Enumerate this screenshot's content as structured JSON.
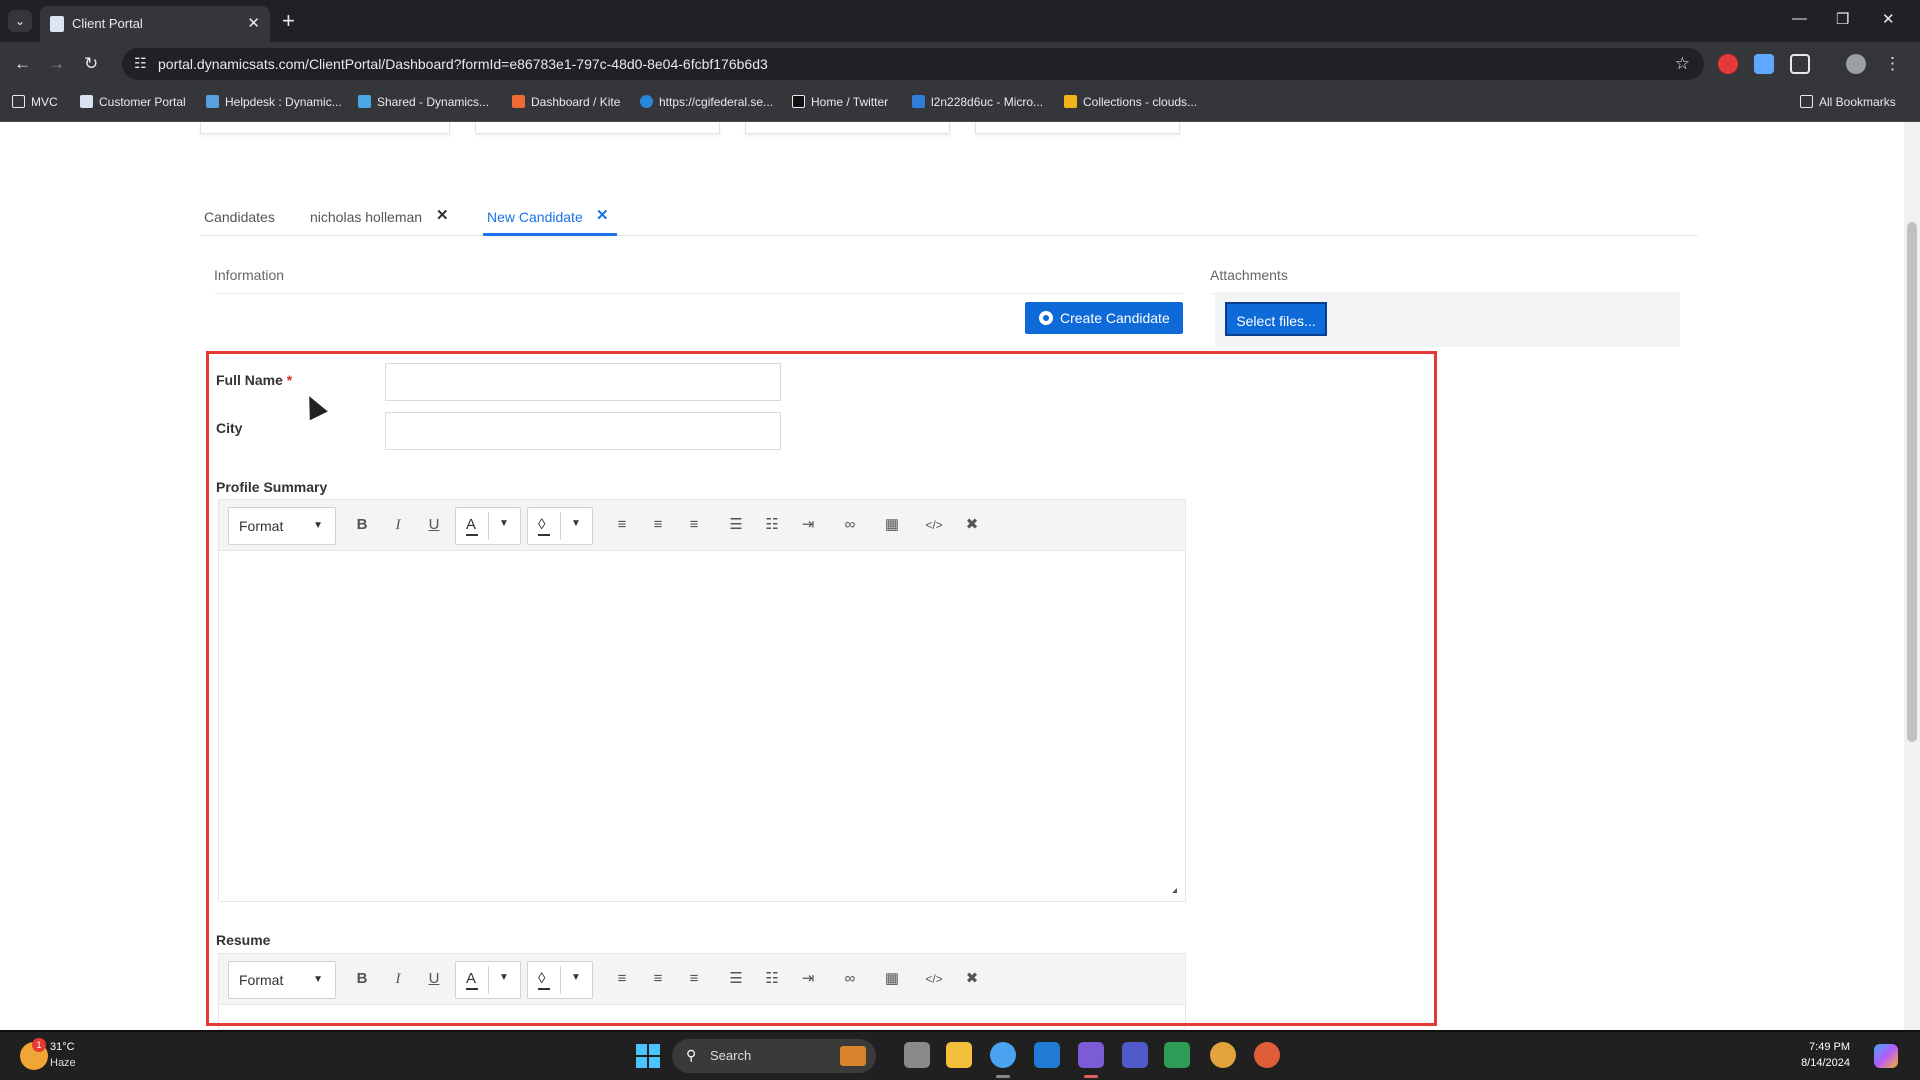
{
  "browser": {
    "tab_title": "Client Portal",
    "url": "portal.dynamicsats.com/ClientPortal/Dashboard?formId=e86783e1-797c-48d0-8e04-6fcbf176b6d3",
    "bookmarks": [
      {
        "label": "MVC",
        "color": "#cfcfcf"
      },
      {
        "label": "Customer Portal",
        "color": "#d9e3f0"
      },
      {
        "label": "Helpdesk : Dynamic...",
        "color": "#5aa0e0"
      },
      {
        "label": "Shared - Dynamics...",
        "color": "#4ca7e6"
      },
      {
        "label": "Dashboard / Kite",
        "color": "#f06a34"
      },
      {
        "label": "https://cgifederal.se...",
        "color": "#2a88d8"
      },
      {
        "label": "Home / Twitter",
        "color": "#111111"
      },
      {
        "label": "l2n228d6uc - Micro...",
        "color": "#2f7fd8"
      },
      {
        "label": "Collections - clouds...",
        "color": "#f2b31b"
      }
    ],
    "all_bookmarks": "All Bookmarks"
  },
  "page": {
    "tabs": [
      {
        "label": "Candidates",
        "closable": false
      },
      {
        "label": "nicholas holleman",
        "closable": true
      },
      {
        "label": "New Candidate",
        "closable": true,
        "active": true
      }
    ],
    "information_heading": "Information",
    "attachments_heading": "Attachments",
    "create_button": "Create Candidate",
    "select_files_button": "Select files...",
    "form": {
      "full_name_label": "Full Name",
      "required_marker": "*",
      "full_name_value": "",
      "city_label": "City",
      "city_value": "",
      "profile_summary_label": "Profile Summary",
      "resume_label": "Resume"
    },
    "editor_toolbar": {
      "format_label": "Format",
      "text_color_glyph": "A",
      "buttons": [
        "bold-icon",
        "italic-icon",
        "underline-icon",
        "align-left-icon",
        "align-center-icon",
        "align-right-icon",
        "bulleted-list-icon",
        "numbered-list-icon",
        "indent-icon",
        "link-icon",
        "table-icon",
        "view-html-icon",
        "clear-formatting-icon"
      ]
    },
    "accent_color": "#0e6ad8",
    "highlight_color": "#e53935"
  },
  "taskbar": {
    "weather_temp": "31°C",
    "weather_cond": "Haze",
    "weather_badge": "1",
    "search_placeholder": "Search",
    "time": "7:49 PM",
    "date": "8/14/2024"
  }
}
